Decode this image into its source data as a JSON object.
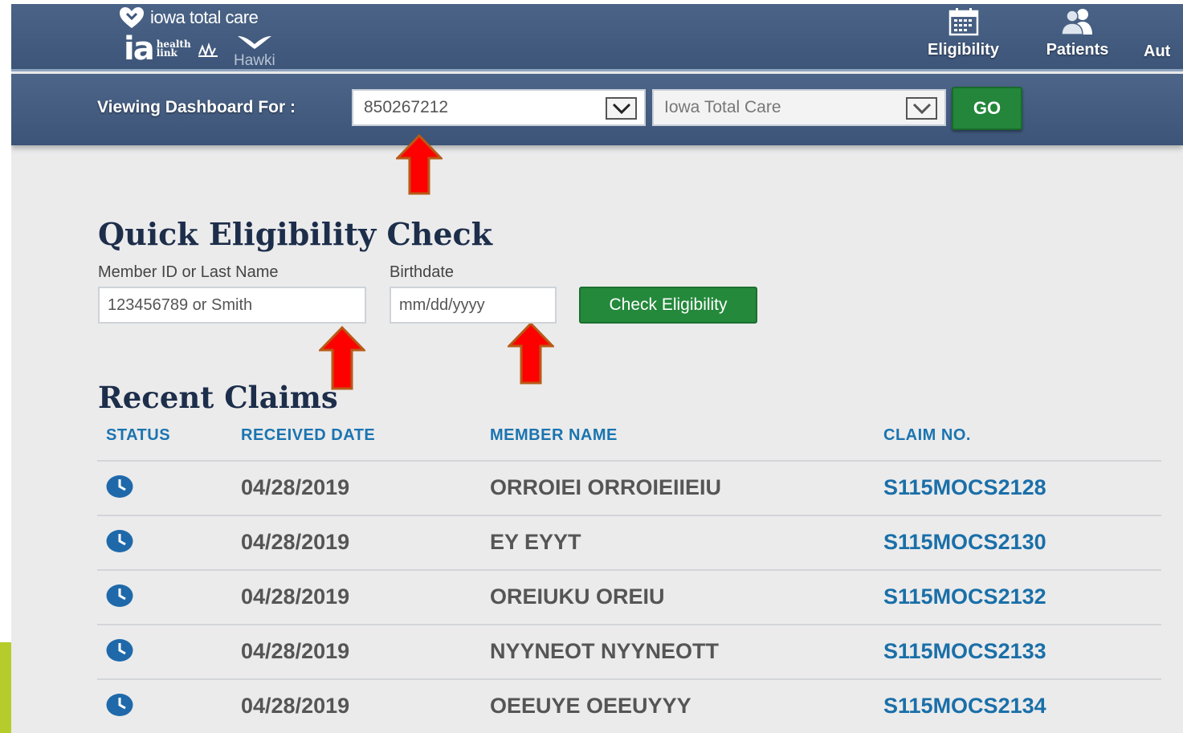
{
  "brand": {
    "name": "iowa total care",
    "ia_logo": "ia",
    "ia_logo_suffix": "health link",
    "hawki": "Hawki"
  },
  "nav": {
    "items": [
      {
        "label": "Eligibility",
        "icon": "calendar-icon"
      },
      {
        "label": "Patients",
        "icon": "people-icon"
      },
      {
        "label": "Aut",
        "icon": ""
      }
    ]
  },
  "dashboard": {
    "label": "Viewing Dashboard For :",
    "provider_id": "850267212",
    "plan": "Iowa Total Care",
    "go_label": "GO"
  },
  "eligibility": {
    "title": "Quick Eligibility Check",
    "member_label": "Member ID or Last Name",
    "member_placeholder": "123456789 or Smith",
    "birth_label": "Birthdate",
    "birth_placeholder": "mm/dd/yyyy",
    "button_label": "Check Eligibility"
  },
  "claims": {
    "title": "Recent Claims",
    "headers": [
      "STATUS",
      "RECEIVED DATE",
      "MEMBER NAME",
      "CLAIM NO."
    ],
    "rows": [
      {
        "status": "clock-icon",
        "date": "04/28/2019",
        "name": "ORROIEI ORROIEIIEIU",
        "claim": "S115MOCS2128"
      },
      {
        "status": "clock-icon",
        "date": "04/28/2019",
        "name": "EY EYYT",
        "claim": "S115MOCS2130"
      },
      {
        "status": "clock-icon",
        "date": "04/28/2019",
        "name": "OREIUKU OREIU",
        "claim": "S115MOCS2132"
      },
      {
        "status": "clock-icon",
        "date": "04/28/2019",
        "name": "NYYNEOT NYYNEOTT",
        "claim": "S115MOCS2133"
      },
      {
        "status": "clock-icon",
        "date": "04/28/2019",
        "name": "OEEUYE OEEUYYY",
        "claim": "S115MOCS2134"
      }
    ]
  },
  "colors": {
    "header_blue": "#3d5579",
    "button_green": "#23863a",
    "link_blue": "#1a74b0",
    "arrow_red": "#ff0000",
    "arrow_outline": "#b85a17"
  }
}
